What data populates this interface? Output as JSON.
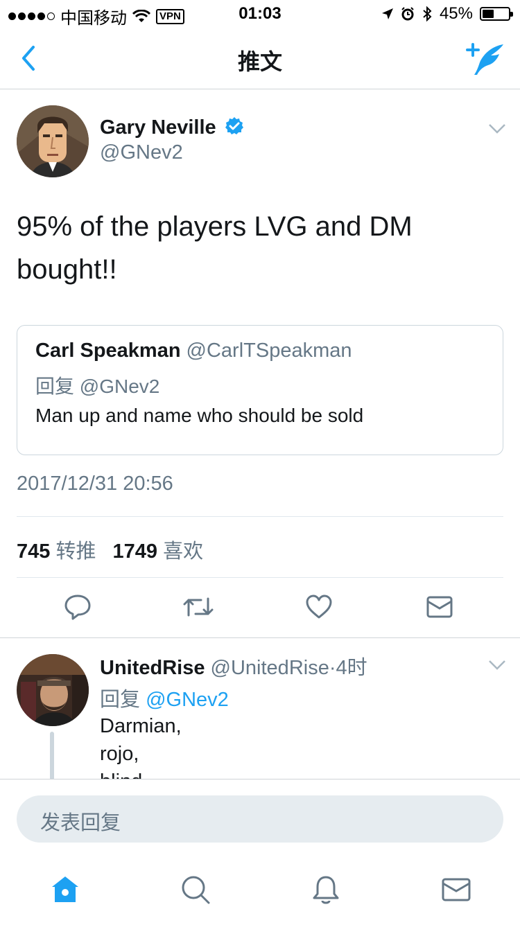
{
  "status_bar": {
    "carrier": "中国移动",
    "vpn": "VPN",
    "time": "01:03",
    "battery": "45%",
    "battery_level": 0.45
  },
  "nav": {
    "title": "推文",
    "back_icon": "chevron-left-icon",
    "compose_icon": "compose-tweet-icon"
  },
  "tweet": {
    "author_name": "Gary Neville",
    "author_handle": "@GNev2",
    "verified": true,
    "text": "95% of the players LVG and DM bought!!",
    "quote": {
      "name": "Carl Speakman",
      "handle": "@CarlTSpeakman",
      "reply_to": "回复 @GNev2",
      "text": "Man up and name who should be sold"
    },
    "timestamp": "2017/12/31 20:56",
    "retweet_count": "745",
    "retweet_label": "转推",
    "like_count": "1749",
    "like_label": "喜欢"
  },
  "reply": {
    "name": "UnitedRise",
    "handle": "@UnitedRise",
    "separator": "·",
    "time": "4时",
    "reply_prefix": "回复",
    "reply_handle": "@GNev2",
    "lines": [
      "Darmian,",
      "rojo,",
      "blind"
    ]
  },
  "composer": {
    "placeholder": "发表回复"
  },
  "colors": {
    "accent": "#1da1f2",
    "secondary_text": "#657786",
    "divider": "#e1e8ed"
  }
}
